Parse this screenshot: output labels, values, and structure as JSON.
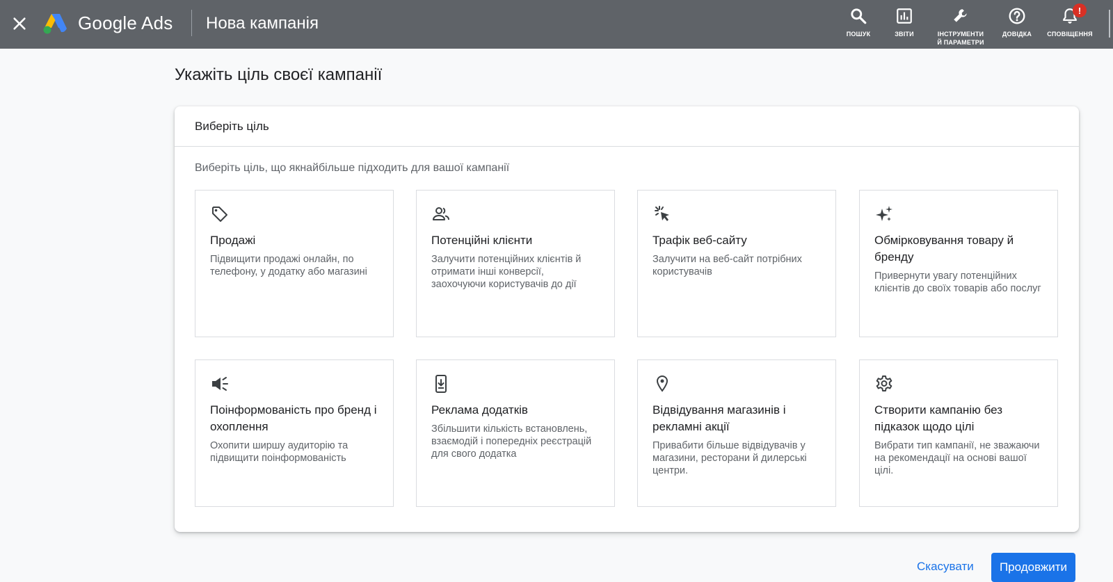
{
  "topbar": {
    "brand": "Google Ads",
    "campaign_title": "Нова кампанія",
    "tools": {
      "search": "Пошук",
      "reports": "Звіти",
      "tools_line1": "Інструменти",
      "tools_line2": "й параметри",
      "help": "Довідка",
      "notifications": "Сповіщення",
      "notification_badge": "!"
    },
    "bg_color": "#5f6368"
  },
  "page": {
    "heading": "Укажіть ціль своєї кампанії"
  },
  "card": {
    "header": "Виберіть ціль",
    "subtitle": "Виберіть ціль, що якнайбільше підходить для вашої кампанії",
    "goals": [
      {
        "icon": "tag-icon",
        "title": "Продажі",
        "desc": "Підвищити продажі онлайн, по телефону, у додатку або магазині"
      },
      {
        "icon": "people-icon",
        "title": "Потенційні клієнти",
        "desc": "Залучити потенційних клієнтів й отримати інші конверсії, заохочуючи користувачів до дії"
      },
      {
        "icon": "cursor-click-icon",
        "title": "Трафік веб-сайту",
        "desc": "Залучити на веб-сайт потрібних користувачів"
      },
      {
        "icon": "sparkle-icon",
        "title": "Обмірковування товару й бренду",
        "desc": "Привернути увагу потенційних клієнтів до своїх товарів або послуг"
      },
      {
        "icon": "megaphone-icon",
        "title": "Поінформованість про бренд і охоплення",
        "desc": "Охопити ширшу аудиторію та підвищити поінформованість"
      },
      {
        "icon": "phone-download-icon",
        "title": "Реклама додатків",
        "desc": "Збільшити кількість встановлень, взаємодій і попередніх реєстрацій для свого додатка"
      },
      {
        "icon": "location-pin-icon",
        "title": "Відвідування магазинів і рекламні акції",
        "desc": "Привабити більше відвідувачів у магазини, ресторани й дилерські центри."
      },
      {
        "icon": "gear-icon",
        "title": "Створити кампанію без підказок щодо цілі",
        "desc": "Вибрати тип кампанії, не зважаючи на рекомендації на основі вашої цілі."
      }
    ]
  },
  "footer": {
    "cancel": "Скасувати",
    "continue": "Продовжити",
    "accent_color": "#1a73e8"
  }
}
